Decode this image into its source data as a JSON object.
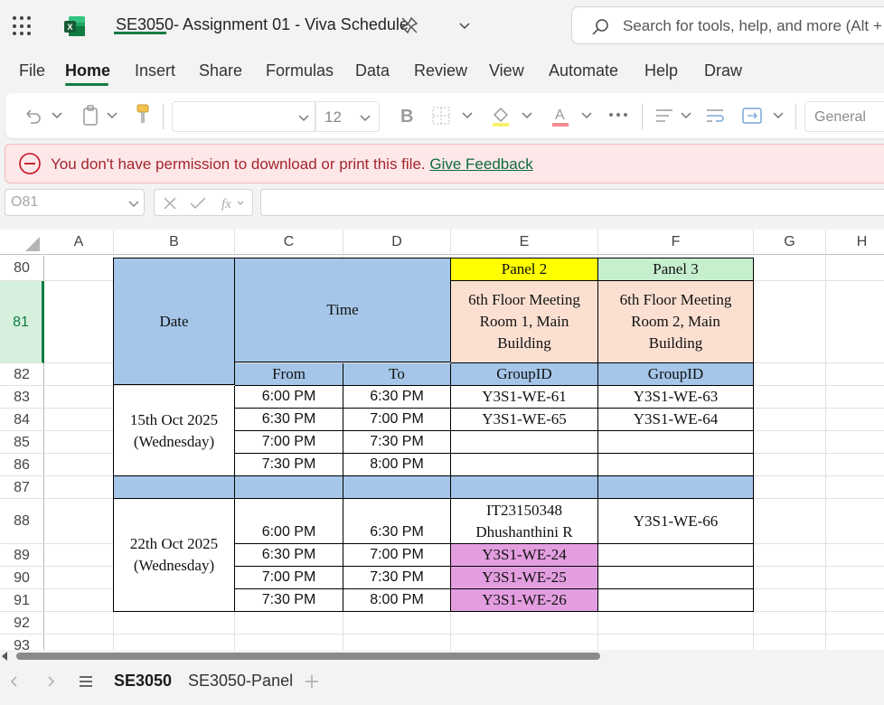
{
  "app": {
    "title": "SE3050- Assignment 01 - Viva Schedule",
    "search_placeholder": "Search for tools, help, and more (Alt + Q)",
    "accent": "#107c41"
  },
  "menu": [
    "File",
    "Home",
    "Insert",
    "Share",
    "Formulas",
    "Data",
    "Review",
    "View",
    "Automate",
    "Help",
    "Draw"
  ],
  "menu_active": "Home",
  "ribbon": {
    "font_size": "12",
    "number_format": "General",
    "icons": [
      "undo-icon",
      "paste-icon",
      "format-painter-icon",
      "bold-icon",
      "borders-icon",
      "fill-color-icon",
      "font-color-icon",
      "more-icon",
      "align-icon",
      "wrap-text-icon",
      "merge-icon"
    ]
  },
  "notice": {
    "text": "You don't have permission to download or print this file.",
    "link": "Give Feedback"
  },
  "formula_bar": {
    "name_box": "O81",
    "formula": ""
  },
  "columns": [
    "A",
    "B",
    "C",
    "D",
    "E",
    "F",
    "G",
    "H"
  ],
  "rows": [
    "80",
    "81",
    "82",
    "83",
    "84",
    "85",
    "86",
    "87",
    "88",
    "89",
    "90",
    "91",
    "92",
    "93"
  ],
  "selected_row": "81",
  "sheet": {
    "date_header": "Date",
    "time_header": "Time",
    "from_header": "From",
    "to_header": "To",
    "panel2": {
      "name": "Panel 2",
      "room": "6th Floor Meeting Room 1, Main Building",
      "groupid": "GroupID"
    },
    "panel3": {
      "name": "Panel 3",
      "room": "6th Floor Meeting Room 2, Main Building",
      "groupid": "GroupID"
    },
    "day1": {
      "date": "15th Oct 2025",
      "weekday": "(Wednesday)",
      "slots": [
        {
          "from": "6:00 PM",
          "to": "6:30 PM",
          "p2": "Y3S1-WE-61",
          "p3": "Y3S1-WE-63"
        },
        {
          "from": "6:30 PM",
          "to": "7:00 PM",
          "p2": "Y3S1-WE-65",
          "p3": "Y3S1-WE-64"
        },
        {
          "from": "7:00 PM",
          "to": "7:30 PM",
          "p2": "",
          "p3": ""
        },
        {
          "from": "7:30 PM",
          "to": "8:00 PM",
          "p2": "",
          "p3": ""
        }
      ]
    },
    "day2": {
      "date": "22th Oct 2025",
      "weekday": "(Wednesday)",
      "slots": [
        {
          "from": "6:00 PM",
          "to": "6:30 PM",
          "p2": "IT23150348",
          "p2_line2": "Dhushanthini R",
          "p3": "Y3S1-WE-66"
        },
        {
          "from": "6:30 PM",
          "to": "7:00 PM",
          "p2": "Y3S1-WE-24",
          "p3": ""
        },
        {
          "from": "7:00 PM",
          "to": "7:30 PM",
          "p2": "Y3S1-WE-25",
          "p3": ""
        },
        {
          "from": "7:30 PM",
          "to": "8:00 PM",
          "p2": "Y3S1-WE-26",
          "p3": ""
        }
      ]
    }
  },
  "sheet_tabs": [
    "SE3050",
    "SE3050-Panel"
  ],
  "sheet_tab_active": "SE3050",
  "colors": {
    "header_blue": "#a5c6e8",
    "panel2_yellow": "#ffff00",
    "panel3_green": "#c6efce",
    "room_peach": "#fbe0d2",
    "highlight_pink": "#e39ee0"
  }
}
